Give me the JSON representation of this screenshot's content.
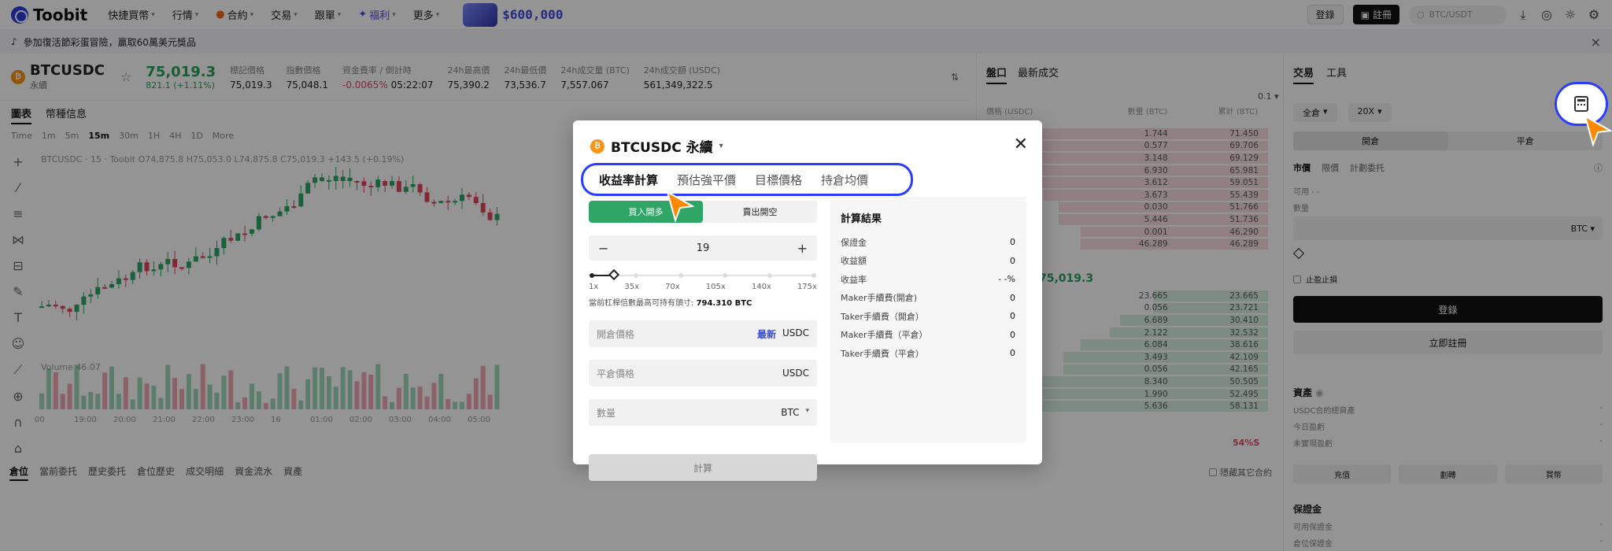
{
  "header": {
    "logo": "Toobit",
    "nav": [
      {
        "label": "快捷買幣",
        "chev": true
      },
      {
        "label": "行情",
        "chev": true
      },
      {
        "label": "合約",
        "chev": true
      },
      {
        "label": "交易",
        "chev": true
      },
      {
        "label": "跟單",
        "chev": true
      },
      {
        "label": "福利",
        "chev": true
      },
      {
        "label": "更多",
        "chev": true
      }
    ],
    "promo_text": "$600,000",
    "login_label": "登錄",
    "register_label": "註冊",
    "search_placeholder": "BTC/USDT"
  },
  "banner": {
    "text": "參加復活節彩蛋冒險，贏取60萬美元獎品"
  },
  "market": {
    "pair": "BTCUSDC",
    "pair_sub": "永續",
    "price": "75,019.3",
    "change": "821.1 (+1.11%)",
    "stats": [
      {
        "label": "標記價格",
        "value": "75,019.3"
      },
      {
        "label": "指數價格",
        "value": "75,048.1"
      },
      {
        "label": "資金費率 / 倒計時",
        "value_red": "-0.0065%",
        "value": "05:22:07"
      },
      {
        "label": "24h最高價",
        "value": "75,390.2"
      },
      {
        "label": "24h最低價",
        "value": "73,536.7"
      },
      {
        "label": "24h成交量 (BTC)",
        "value": "7,557.067"
      },
      {
        "label": "24h成交額 (USDC)",
        "value": "561,349,322.5"
      }
    ]
  },
  "chart": {
    "tabs": [
      "圖表",
      "幣種信息"
    ],
    "timeframes": [
      "Time",
      "1m",
      "5m",
      "15m",
      "30m",
      "1H",
      "4H",
      "1D",
      "More"
    ],
    "active_tf": "15m",
    "legend": "BTCUSDC · 15 · Toobit  O74,875.8  H75,053.0  L74,875.8  C75,019.3  +143.5 (+0.19%)",
    "volume_label": "Volume  46.07",
    "times": [
      "00",
      "19:00",
      "20:00",
      "21:00",
      "22:00",
      "23:00",
      "16",
      "01:00",
      "02:00",
      "03:00",
      "04:00",
      "05:00"
    ],
    "bottom_tabs": [
      "倉位",
      "當前委托",
      "歷史委托",
      "倉位歷史",
      "成交明細",
      "資金流水",
      "資產"
    ],
    "hide_others": "隱藏其它合約"
  },
  "orderbook": {
    "tabs": [
      "盤口",
      "最新成交"
    ],
    "spread": "0.1",
    "head": [
      "價格 (USDC)",
      "數量 (BTC)",
      "累計 (BTC)"
    ],
    "asks": [
      [
        "",
        "1.744",
        "71.450"
      ],
      [
        "",
        "0.577",
        "69.706"
      ],
      [
        "",
        "3.148",
        "69.129"
      ],
      [
        "",
        "6.930",
        "65.981"
      ],
      [
        "",
        "3.612",
        "59.051"
      ],
      [
        "",
        "3.673",
        "55.439"
      ],
      [
        "",
        "0.030",
        "51.766"
      ],
      [
        "",
        "5.446",
        "51.736"
      ],
      [
        "",
        "0.001",
        "46.290"
      ],
      [
        "",
        "46.289",
        "46.289"
      ]
    ],
    "mid_price": "75,019.3",
    "bids": [
      [
        "",
        "23.665",
        "23.665"
      ],
      [
        "",
        "0.056",
        "23.721"
      ],
      [
        "",
        "6.689",
        "30.410"
      ],
      [
        "",
        "2.122",
        "32.532"
      ],
      [
        "",
        "6.084",
        "38.616"
      ],
      [
        "",
        "3.493",
        "42.109"
      ],
      [
        "",
        "0.056",
        "42.165"
      ],
      [
        "",
        "8.340",
        "50.505"
      ],
      [
        "",
        "1.990",
        "52.495"
      ],
      [
        "",
        "5.636",
        "58.131"
      ]
    ],
    "pct": "54%S"
  },
  "trade": {
    "tabs": [
      "交易",
      "工具"
    ],
    "margin_mode": "全倉",
    "leverage": "20X",
    "open_label": "開倉",
    "close_label": "平倉",
    "order_types": [
      "市價",
      "限價",
      "計劃委托"
    ],
    "available": "可用 - -",
    "qty_label": "數量",
    "qty_unit": "BTC",
    "tpsl": "止盈止損",
    "login_btn": "登錄",
    "register_btn": "立即註冊",
    "assets_title": "資產",
    "asset_rows": [
      "USDC合約總資產",
      "今日盈虧",
      "未實現盈虧"
    ],
    "asset_buttons": [
      "充值",
      "劃轉",
      "買幣"
    ],
    "margin_title": "保證金",
    "margin_rows": [
      "可用保證金",
      "倉位保證金"
    ]
  },
  "modal": {
    "title": "BTCUSDC 永續",
    "tabs": [
      "收益率計算",
      "預估強平價",
      "目標價格",
      "持倉均價"
    ],
    "long_label": "買入開多",
    "short_label": "賣出開空",
    "leverage_value": "19",
    "leverage_ticks": [
      "1x",
      "35x",
      "70x",
      "105x",
      "140x",
      "175x"
    ],
    "leverage_fraction": 0.1,
    "max_note_prefix": "當前杠桿倍數最高可持有頭寸: ",
    "max_note_value": "794.310 BTC",
    "open_price_placeholder": "開倉價格",
    "latest_label": "最新",
    "close_price_placeholder": "平倉價格",
    "unit_usdc": "USDC",
    "qty_placeholder": "數量",
    "qty_unit": "BTC",
    "calc_button": "計算",
    "result_title": "計算結果",
    "results": [
      {
        "label": "保證金",
        "value": "0"
      },
      {
        "label": "收益額",
        "value": "0"
      },
      {
        "label": "收益率",
        "value": "- -%"
      },
      {
        "label": "Maker手續費(開倉)",
        "value": "0"
      },
      {
        "label": "Taker手續費（開倉）",
        "value": "0"
      },
      {
        "label": "Maker手續費（平倉）",
        "value": "0"
      },
      {
        "label": "Taker手續費（平倉）",
        "value": "0"
      }
    ]
  },
  "colors": {
    "accent": "#2b3cff",
    "up": "#2fa566",
    "down": "#e0485c",
    "cursor": "#ff8a00"
  }
}
